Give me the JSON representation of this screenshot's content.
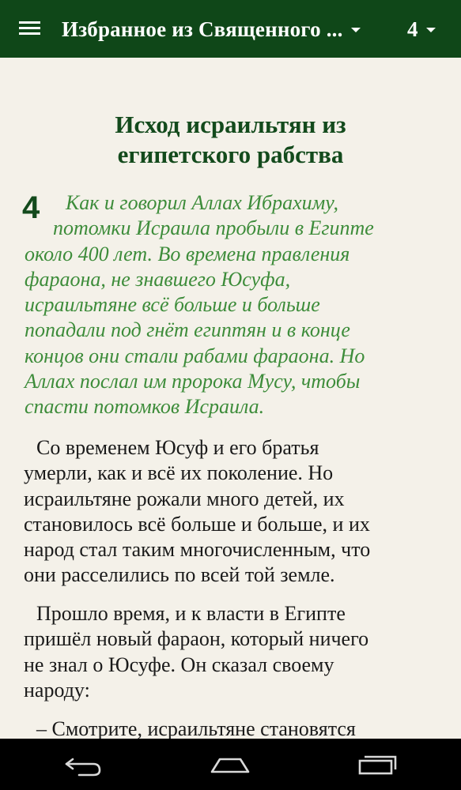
{
  "appbar": {
    "book_title": "Избранное из Священного ...",
    "chapter": "4"
  },
  "content": {
    "heading_line1": "Исход исраильтян из",
    "heading_line2": "египетского рабства",
    "chapter_label": "4",
    "intro_lines": [
      "Как и говорил Аллах Ибрахиму,",
      "потомки Исраила пробыли в Египте",
      "около 400 лет. Во времена правления",
      "фараона, не знавшего Юсуфа,",
      "исраильтяне всё больше и больше",
      "попадали под гнёт египтян и в конце",
      "концов они стали рабами фараона. Но",
      "Аллах послал им пророка Мусу, чтобы",
      "спасти потомков Исраила."
    ],
    "paragraph1_lines": [
      "Со временем Юсуф и его братья",
      "умерли, как и всё их поколение. Но",
      "исраильтяне рожали много детей, их",
      "становилось всё больше и больше, и их",
      "народ стал таким многочисленным, что",
      "они расселились по всей той земле."
    ],
    "paragraph2_lines": [
      "Прошло время, и к власти в Египте",
      "пришёл новый фараон, который ничего",
      "не знал о Юсуфе. Он сказал своему",
      "народу:"
    ],
    "paragraph3_lines": [
      "– Смотрите, исраильтяне становятся"
    ]
  },
  "colors": {
    "appbar_bg": "#0f4718",
    "heading": "#134a1c",
    "intro_text": "#3d8c3a",
    "body_text": "#1a1a1a",
    "page_bg": "#f4f1e9"
  },
  "navbar": {
    "icons": [
      "back-icon",
      "home-icon",
      "recent-apps-icon"
    ]
  }
}
